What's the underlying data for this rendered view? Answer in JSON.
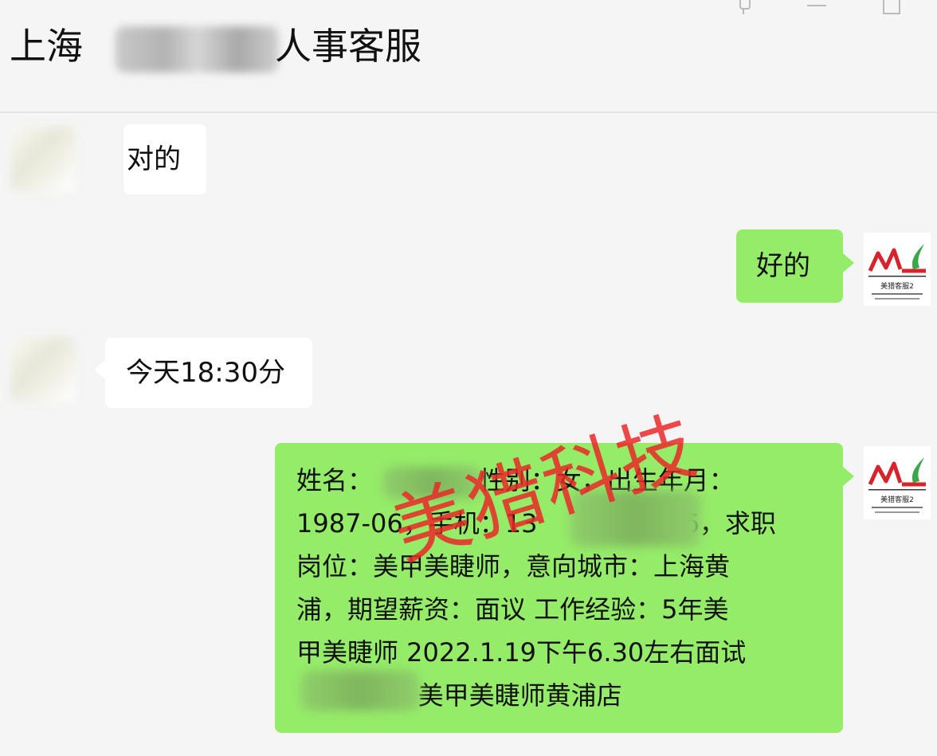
{
  "header": {
    "title_prefix": "上海",
    "title_suffix": "人事客服"
  },
  "messages": [
    {
      "side": "left",
      "text": "对的"
    },
    {
      "side": "right",
      "text": "好的"
    },
    {
      "side": "left",
      "text": "今天18:30分"
    },
    {
      "side": "right",
      "lines": [
        "姓名：          ，性别：女，出生年月：",
        "1987-06，手机：13                26，求职",
        "岗位：美甲美睫师，意向城市：上海黄",
        "浦，期望薪资：面议 工作经验：5年美",
        "甲美睫师 2022.1.19下午6.30左右面试",
        "               美甲美睫师黄浦店"
      ]
    }
  ],
  "logo": {
    "text_main": "ML",
    "caption": "美猎客服2"
  },
  "watermark": "美猎科技",
  "colors": {
    "background": "#f5f5f5",
    "bubble_self": "#95ec69",
    "bubble_other": "#ffffff",
    "watermark": "#eb2828"
  },
  "icons": [
    "pin-icon",
    "minimize-icon",
    "maximize-icon"
  ]
}
